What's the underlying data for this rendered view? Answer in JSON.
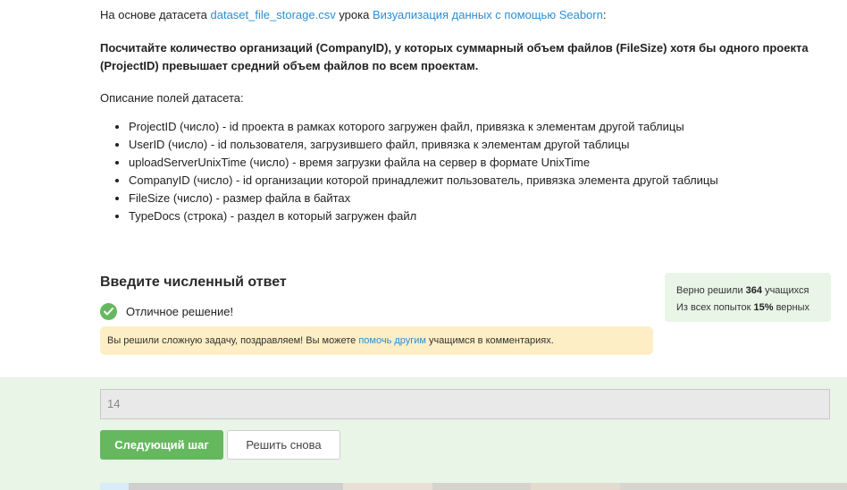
{
  "intro": {
    "prefix": "На основе датасета ",
    "dataset_link": "dataset_file_storage.csv",
    "middle": " урока ",
    "lesson_link": "Визуализация данных с помощью Seaborn",
    "suffix": ":"
  },
  "task": "Посчитайте количество организаций (CompanyID), у которых суммарный объем файлов (FileSize) хотя бы одного проекта (ProjectID) превышает средний объем файлов по всем проектам.",
  "description_title": "Описание полей датасета:",
  "fields": [
    "ProjectID (число) - id проекта в рамках которого загружен файл, привязка к элементам другой таблицы",
    "UserID (число) - id пользователя, загрузившего файл, привязка к элементам другой таблицы",
    "uploadServerUnixTime (число) - время загрузки файла на сервер в формате UnixTime",
    "CompanyID (число) - id организации которой принадлежит пользователь, привязка элемента другой таблицы",
    "FileSize (число) - размер файла в байтах",
    "TypeDocs (строка) - раздел в который загружен файл"
  ],
  "answer_title": "Введите численный ответ",
  "success_text": "Отличное решение!",
  "notice": {
    "prefix": "Вы решили сложную задачу, поздравляем! Вы можете ",
    "link": "помочь другим",
    "suffix": " учащимся в комментариях."
  },
  "stats": {
    "line1_prefix": "Верно решили ",
    "line1_count": "364",
    "line1_suffix": " учащихся",
    "line2_prefix": "Из всех попыток ",
    "line2_percent": "15%",
    "line2_suffix": " верных"
  },
  "answer_value": "14",
  "buttons": {
    "next": "Следующий шаг",
    "retry": "Решить снова"
  },
  "colors": {
    "accent_green": "#66b85f",
    "link_blue": "#2a8fd6",
    "notice_bg": "#fdeec5",
    "green_zone": "#e9f5e7"
  }
}
